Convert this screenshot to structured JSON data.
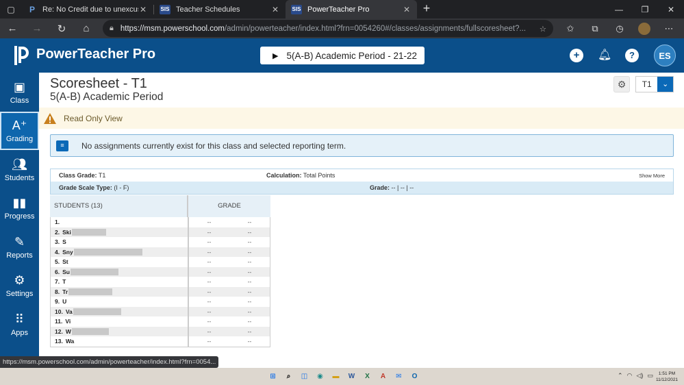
{
  "browser": {
    "tabs": [
      {
        "label": "Re: No Credit due to unexcused",
        "favicon": "P"
      },
      {
        "label": "Teacher Schedules",
        "favicon": "SIS"
      },
      {
        "label": "PowerTeacher Pro",
        "favicon": "SIS",
        "active": true
      }
    ],
    "url_host": "https://msm.powerschool.com",
    "url_path": "/admin/powerteacher/index.html?frn=0054260#/classes/assignments/fullscoresheet?..."
  },
  "app": {
    "brand": "PowerTeacher Pro",
    "class_picker": "5(A-B) Academic Period - 21-22",
    "user_initials": "ES",
    "accent": "#0b4f8a"
  },
  "sidebar": [
    {
      "label": "Class",
      "icon": "class-icon"
    },
    {
      "label": "Grading",
      "icon": "grading-icon",
      "active": true
    },
    {
      "label": "Students",
      "icon": "students-icon"
    },
    {
      "label": "Progress",
      "icon": "progress-icon"
    },
    {
      "label": "Reports",
      "icon": "reports-icon"
    },
    {
      "label": "Settings",
      "icon": "settings-icon"
    },
    {
      "label": "Apps",
      "icon": "apps-icon"
    }
  ],
  "page": {
    "title": "Scoresheet - T1",
    "subtitle": "5(A-B) Academic Period",
    "term": "T1",
    "read_only": "Read Only View",
    "info": "No assignments currently exist for this class and selected reporting term."
  },
  "grade_summary": {
    "class_grade_label": "Class Grade:",
    "class_grade_value": "T1",
    "calculation_label": "Calculation:",
    "calculation_value": "Total Points",
    "show_more": "Show More",
    "scale_label": "Grade Scale Type:",
    "scale_value": "(I - F)",
    "grade_label": "Grade:",
    "grade_value": "-- | -- | --"
  },
  "students_table": {
    "col_students": "STUDENTS (13)",
    "col_grade": "GRADE",
    "rows": [
      {
        "num": "1.",
        "name": "",
        "redact": 0,
        "grade": "--",
        "pct": "--"
      },
      {
        "num": "2.",
        "name": "Ski",
        "redact": 50,
        "grade": "--",
        "pct": "--"
      },
      {
        "num": "3.",
        "name": "S",
        "redact": 0,
        "grade": "--",
        "pct": "--"
      },
      {
        "num": "4.",
        "name": "Sny",
        "redact": 100,
        "grade": "--",
        "pct": "--"
      },
      {
        "num": "5.",
        "name": "St",
        "redact": 0,
        "grade": "--",
        "pct": "--"
      },
      {
        "num": "6.",
        "name": "Su",
        "redact": 70,
        "grade": "--",
        "pct": "--"
      },
      {
        "num": "7.",
        "name": "T",
        "redact": 0,
        "grade": "--",
        "pct": "--"
      },
      {
        "num": "8.",
        "name": "Tr",
        "redact": 64,
        "grade": "--",
        "pct": "--"
      },
      {
        "num": "9.",
        "name": "U",
        "redact": 0,
        "grade": "--",
        "pct": "--"
      },
      {
        "num": "10.",
        "name": "Va",
        "redact": 70,
        "grade": "--",
        "pct": "--"
      },
      {
        "num": "11.",
        "name": "Vi",
        "redact": 0,
        "grade": "--",
        "pct": "--"
      },
      {
        "num": "12.",
        "name": "W",
        "redact": 54,
        "grade": "--",
        "pct": "--"
      },
      {
        "num": "13.",
        "name": "Wa",
        "redact": 0,
        "grade": "--",
        "pct": "--"
      }
    ]
  },
  "status_url": "https://msm.powerschool.com/admin/powerteacher/index.html?frn=0054...",
  "taskbar": {
    "time": "1:51 PM",
    "date": "11/12/2021"
  }
}
